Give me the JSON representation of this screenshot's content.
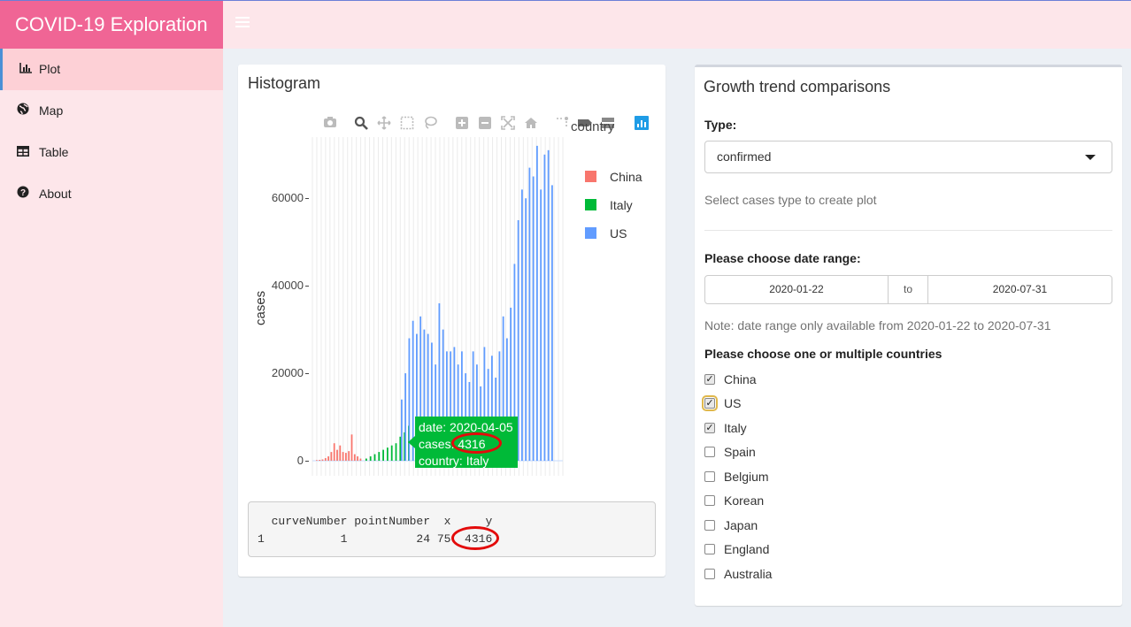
{
  "header": {
    "app_title": "COVID-19 Exploration"
  },
  "sidebar": {
    "items": [
      {
        "label": "Plot",
        "icon": "bar-chart-icon",
        "active": true
      },
      {
        "label": "Map",
        "icon": "globe-icon",
        "active": false
      },
      {
        "label": "Table",
        "icon": "table-icon",
        "active": false
      },
      {
        "label": "About",
        "icon": "question-circle-icon",
        "active": false
      }
    ]
  },
  "histogram": {
    "title": "Histogram",
    "tooltip": {
      "line1": "date: 2020-04-05",
      "line2_prefix": "cases:",
      "line2_value": "4316",
      "line3": "country: Italy"
    },
    "click_output": {
      "header": "  curveNumber pointNumber  x     y",
      "row": "1           1          24 75  4316"
    }
  },
  "chart_data": {
    "type": "bar",
    "title": "",
    "xlabel": "",
    "ylabel": "cases",
    "ylim": [
      0,
      74000
    ],
    "yticks": [
      "0",
      "20000",
      "40000",
      "60000"
    ],
    "legend": {
      "title": "country",
      "entries": [
        "China",
        "Italy",
        "US"
      ],
      "placement": "right"
    },
    "grid": true,
    "colors": {
      "China": "#f8766d",
      "Italy": "#00ba38",
      "US": "#619cff"
    },
    "series": [
      {
        "name": "China",
        "values": [
          150,
          200,
          300,
          600,
          1000,
          2000,
          4000,
          2500,
          3500,
          2000,
          1800,
          2200,
          6000,
          1500,
          1000,
          500
        ]
      },
      {
        "name": "Italy",
        "values": [
          500,
          1000,
          1500,
          2000,
          2500,
          3000,
          3500,
          4000,
          5500,
          6500,
          8000,
          5500,
          6000,
          5000,
          4316,
          4000,
          3500
        ]
      },
      {
        "name": "US",
        "values": [
          14000,
          20000,
          28000,
          32000,
          29000,
          33000,
          30000,
          29000,
          27000,
          22000,
          36000,
          30000,
          25000,
          25000,
          26000,
          22000,
          25000,
          20000,
          18000,
          25000,
          22000,
          17000,
          26000,
          21000,
          24000,
          19000,
          25000,
          33000,
          28000,
          35000,
          45000,
          55000,
          62000,
          60000,
          67000,
          65000,
          72000,
          62000,
          70000,
          71000,
          63000
        ]
      }
    ]
  },
  "controls": {
    "title": "Growth trend comparisons",
    "type_label": "Type:",
    "type_value": "confirmed",
    "type_help": "Select cases type to create plot",
    "date_label": "Please choose date range:",
    "date_start": "2020-01-22",
    "date_sep": "to",
    "date_end": "2020-07-31",
    "date_note": "Note: date range only available from 2020-01-22 to 2020-07-31",
    "countries_label": "Please choose one or multiple countries",
    "countries": [
      {
        "label": "China",
        "checked": true
      },
      {
        "label": "US",
        "checked": true,
        "focused": true
      },
      {
        "label": "Italy",
        "checked": true
      },
      {
        "label": "Spain",
        "checked": false
      },
      {
        "label": "Belgium",
        "checked": false
      },
      {
        "label": "Korean",
        "checked": false
      },
      {
        "label": "Japan",
        "checked": false
      },
      {
        "label": "England",
        "checked": false
      },
      {
        "label": "Australia",
        "checked": false
      }
    ]
  }
}
